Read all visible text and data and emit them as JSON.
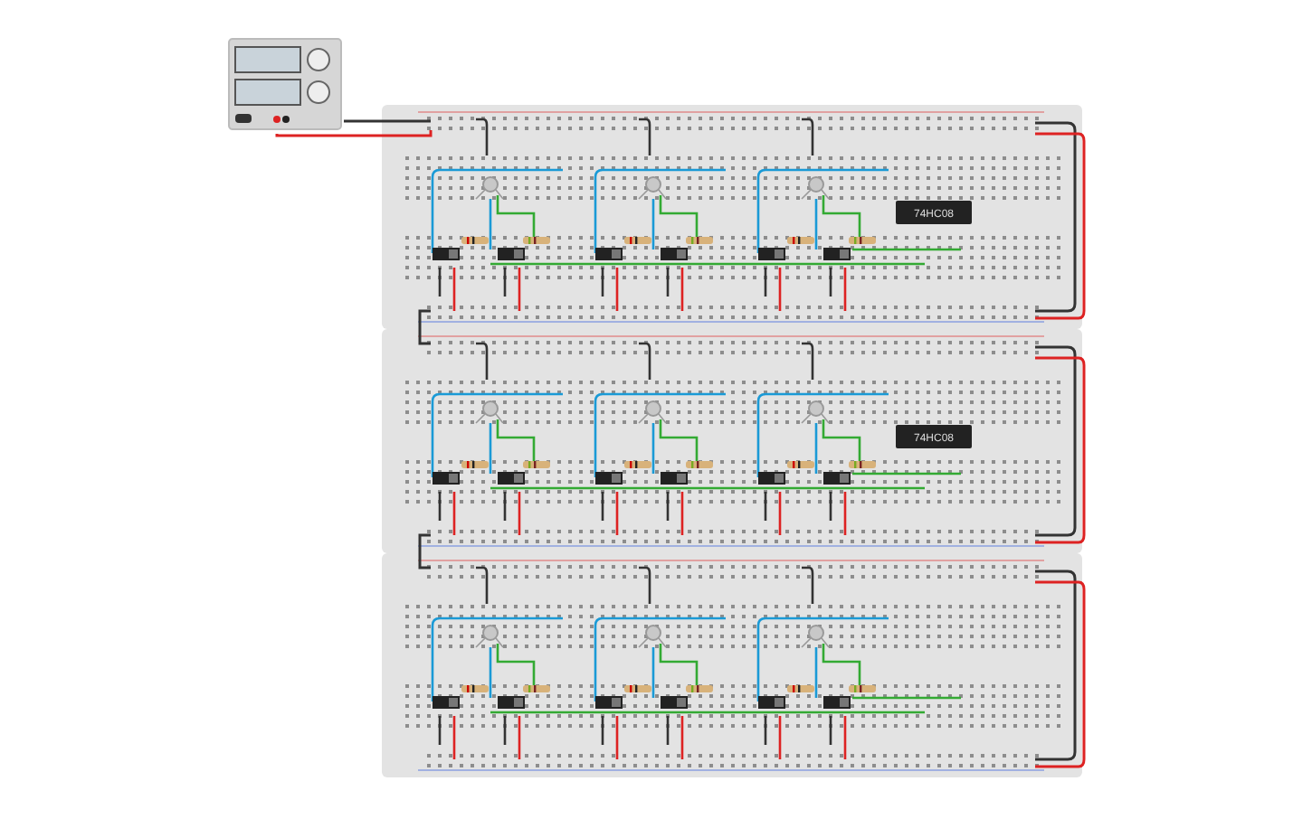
{
  "power_supply": {
    "kind": "dual-display"
  },
  "boards": [
    {
      "chip": {
        "label": "74HC08"
      },
      "stages": [
        {
          "kind": "switch-led",
          "switches": [
            {
              "on": false
            },
            {
              "on": false
            }
          ]
        },
        {
          "kind": "switch-led",
          "switches": [
            {
              "on": false
            },
            {
              "on": false
            }
          ]
        },
        {
          "kind": "switch-led",
          "switches": [
            {
              "on": false
            },
            {
              "on": false
            }
          ]
        }
      ]
    },
    {
      "chip": {
        "label": "74HC08"
      },
      "stages": [
        {
          "kind": "switch-led",
          "switches": [
            {
              "on": false
            },
            {
              "on": false
            }
          ]
        },
        {
          "kind": "switch-led",
          "switches": [
            {
              "on": false
            },
            {
              "on": false
            }
          ]
        },
        {
          "kind": "switch-led",
          "switches": [
            {
              "on": false
            },
            {
              "on": false
            }
          ]
        }
      ]
    },
    {
      "stages": [
        {
          "kind": "switch-led",
          "switches": [
            {
              "on": false
            },
            {
              "on": false
            }
          ]
        },
        {
          "kind": "switch-led",
          "switches": [
            {
              "on": false
            },
            {
              "on": false
            }
          ]
        },
        {
          "kind": "switch-led",
          "switches": [
            {
              "on": false
            },
            {
              "on": false
            }
          ]
        }
      ]
    }
  ]
}
